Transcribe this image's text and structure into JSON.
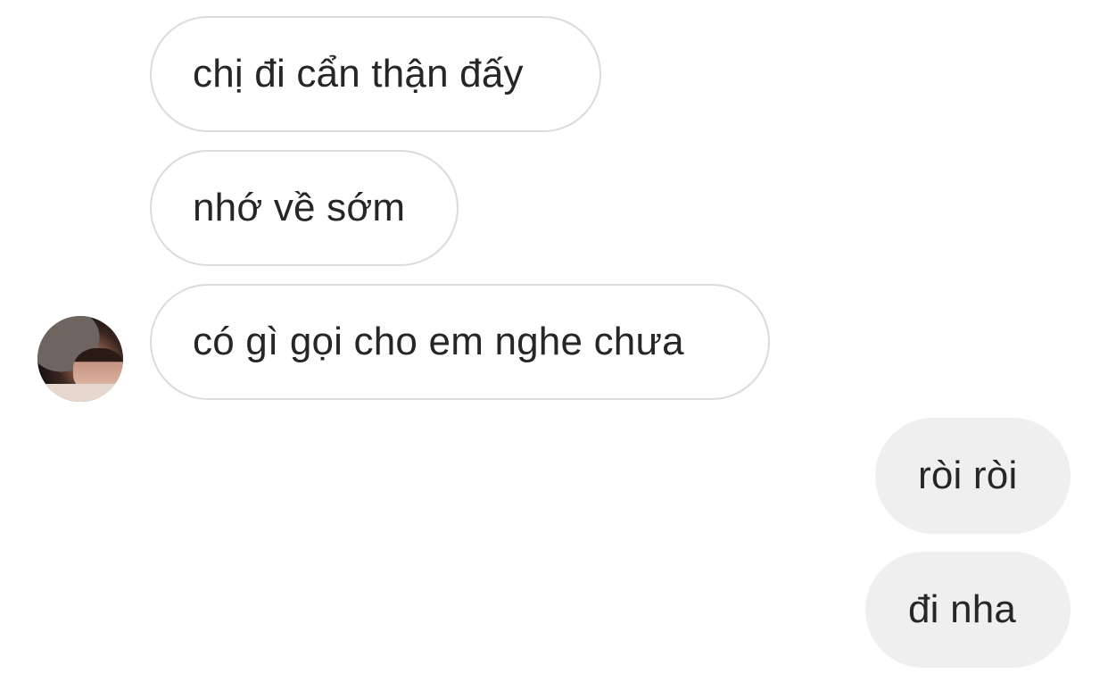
{
  "messages": [
    {
      "side": "received",
      "text": "chị đi cẩn thận đấy"
    },
    {
      "side": "received",
      "text": "nhớ về sớm"
    },
    {
      "side": "received",
      "text": "có gì gọi cho em nghe chưa"
    },
    {
      "side": "sent",
      "text": "ròi ròi"
    },
    {
      "side": "sent",
      "text": "đi nha"
    }
  ],
  "colors": {
    "received_bubble_bg": "#ffffff",
    "received_bubble_border": "#dbdbdb",
    "sent_bubble_bg": "#efefef",
    "text": "#262626"
  }
}
